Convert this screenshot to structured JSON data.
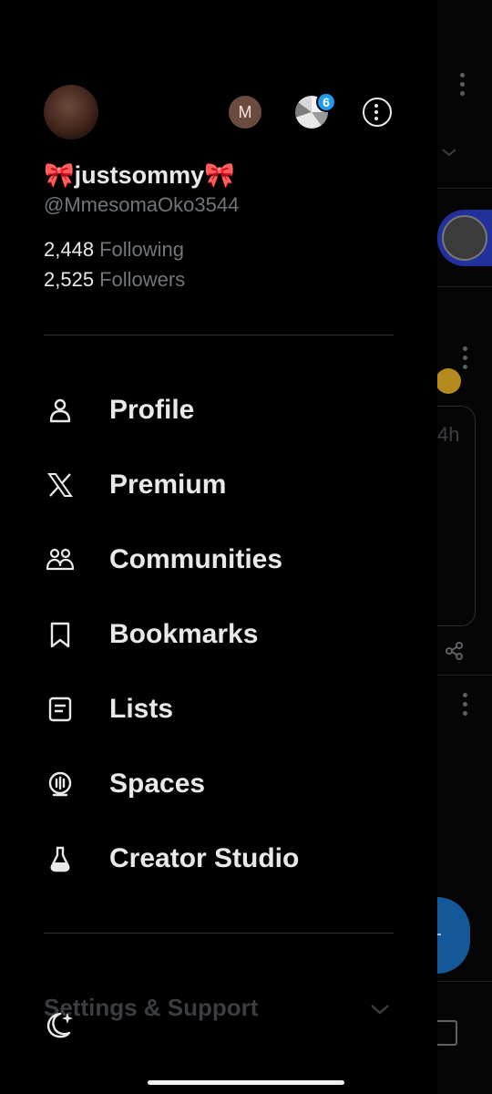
{
  "profile": {
    "display_name": "🎀justsommy🎀",
    "handle": "@MmesomaOko3544",
    "following_count": "2,448",
    "following_label": "Following",
    "followers_count": "2,525",
    "followers_label": "Followers"
  },
  "accounts": {
    "other_account_initial": "M",
    "notification_badge": "6"
  },
  "menu": [
    {
      "label": "Profile",
      "icon": "person-icon"
    },
    {
      "label": "Premium",
      "icon": "x-logo-icon"
    },
    {
      "label": "Communities",
      "icon": "communities-icon"
    },
    {
      "label": "Bookmarks",
      "icon": "bookmark-icon"
    },
    {
      "label": "Lists",
      "icon": "list-icon"
    },
    {
      "label": "Spaces",
      "icon": "spaces-icon"
    },
    {
      "label": "Creator Studio",
      "icon": "flask-icon"
    }
  ],
  "footer": {
    "settings_label": "Settings & Support"
  },
  "background_feed": {
    "timestamp_fragment": "4h"
  },
  "colors": {
    "background": "#000000",
    "primary_text": "#e7e9ea",
    "secondary_text": "#71767b",
    "divider": "#2f3336",
    "accent": "#1d9bf0"
  }
}
